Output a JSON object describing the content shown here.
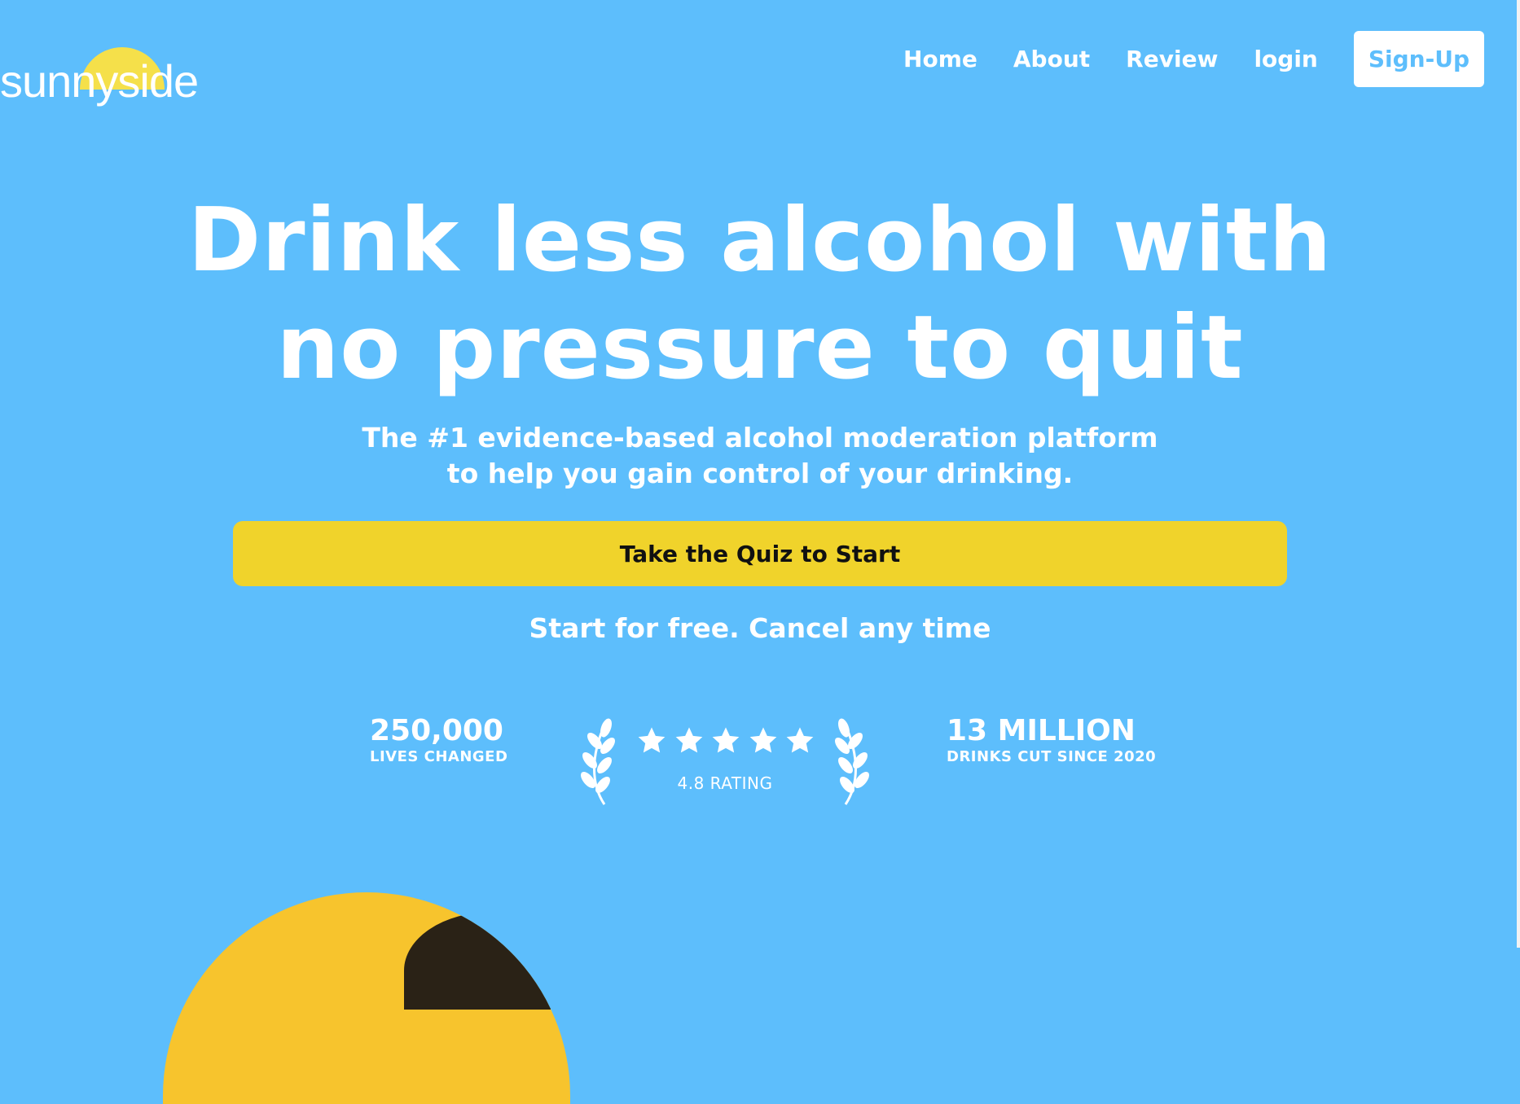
{
  "brand": {
    "logo_text": "sunnyside",
    "sun_color": "#f5e04a"
  },
  "nav": {
    "items": [
      {
        "label": "Home"
      },
      {
        "label": "About"
      },
      {
        "label": "Review"
      },
      {
        "label": "login"
      }
    ],
    "signup_label": "Sign-Up"
  },
  "hero": {
    "headline_line1": "Drink less alcohol with",
    "headline_line2": "no pressure to quit",
    "subhead_line1": "The #1 evidence-based alcohol moderation platform",
    "subhead_line2": "to help you gain control of your drinking.",
    "cta_label": "Take the Quiz to Start",
    "free_note": "Start for free. Cancel any time"
  },
  "stats": {
    "lives": {
      "value": "250,000",
      "label": "LIVES CHANGED"
    },
    "rating": {
      "stars": 5,
      "label": "4.8 RATING"
    },
    "drinks": {
      "value": "13 MILLION",
      "label": "DRINKS CUT SINCE 2020"
    }
  },
  "colors": {
    "background": "#5dbefc",
    "cta": "#f0d32b",
    "hero_image": "#f7c42d"
  }
}
